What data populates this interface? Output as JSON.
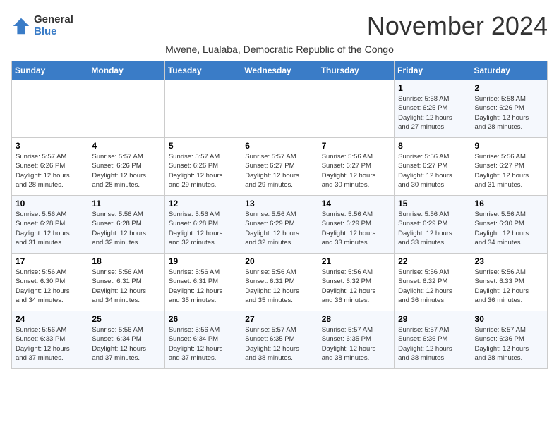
{
  "logo": {
    "general": "General",
    "blue": "Blue"
  },
  "title": "November 2024",
  "subtitle": "Mwene, Lualaba, Democratic Republic of the Congo",
  "days_of_week": [
    "Sunday",
    "Monday",
    "Tuesday",
    "Wednesday",
    "Thursday",
    "Friday",
    "Saturday"
  ],
  "weeks": [
    [
      {
        "day": "",
        "info": ""
      },
      {
        "day": "",
        "info": ""
      },
      {
        "day": "",
        "info": ""
      },
      {
        "day": "",
        "info": ""
      },
      {
        "day": "",
        "info": ""
      },
      {
        "day": "1",
        "info": "Sunrise: 5:58 AM\nSunset: 6:25 PM\nDaylight: 12 hours\nand 27 minutes."
      },
      {
        "day": "2",
        "info": "Sunrise: 5:58 AM\nSunset: 6:26 PM\nDaylight: 12 hours\nand 28 minutes."
      }
    ],
    [
      {
        "day": "3",
        "info": "Sunrise: 5:57 AM\nSunset: 6:26 PM\nDaylight: 12 hours\nand 28 minutes."
      },
      {
        "day": "4",
        "info": "Sunrise: 5:57 AM\nSunset: 6:26 PM\nDaylight: 12 hours\nand 28 minutes."
      },
      {
        "day": "5",
        "info": "Sunrise: 5:57 AM\nSunset: 6:26 PM\nDaylight: 12 hours\nand 29 minutes."
      },
      {
        "day": "6",
        "info": "Sunrise: 5:57 AM\nSunset: 6:27 PM\nDaylight: 12 hours\nand 29 minutes."
      },
      {
        "day": "7",
        "info": "Sunrise: 5:56 AM\nSunset: 6:27 PM\nDaylight: 12 hours\nand 30 minutes."
      },
      {
        "day": "8",
        "info": "Sunrise: 5:56 AM\nSunset: 6:27 PM\nDaylight: 12 hours\nand 30 minutes."
      },
      {
        "day": "9",
        "info": "Sunrise: 5:56 AM\nSunset: 6:27 PM\nDaylight: 12 hours\nand 31 minutes."
      }
    ],
    [
      {
        "day": "10",
        "info": "Sunrise: 5:56 AM\nSunset: 6:28 PM\nDaylight: 12 hours\nand 31 minutes."
      },
      {
        "day": "11",
        "info": "Sunrise: 5:56 AM\nSunset: 6:28 PM\nDaylight: 12 hours\nand 32 minutes."
      },
      {
        "day": "12",
        "info": "Sunrise: 5:56 AM\nSunset: 6:28 PM\nDaylight: 12 hours\nand 32 minutes."
      },
      {
        "day": "13",
        "info": "Sunrise: 5:56 AM\nSunset: 6:29 PM\nDaylight: 12 hours\nand 32 minutes."
      },
      {
        "day": "14",
        "info": "Sunrise: 5:56 AM\nSunset: 6:29 PM\nDaylight: 12 hours\nand 33 minutes."
      },
      {
        "day": "15",
        "info": "Sunrise: 5:56 AM\nSunset: 6:29 PM\nDaylight: 12 hours\nand 33 minutes."
      },
      {
        "day": "16",
        "info": "Sunrise: 5:56 AM\nSunset: 6:30 PM\nDaylight: 12 hours\nand 34 minutes."
      }
    ],
    [
      {
        "day": "17",
        "info": "Sunrise: 5:56 AM\nSunset: 6:30 PM\nDaylight: 12 hours\nand 34 minutes."
      },
      {
        "day": "18",
        "info": "Sunrise: 5:56 AM\nSunset: 6:31 PM\nDaylight: 12 hours\nand 34 minutes."
      },
      {
        "day": "19",
        "info": "Sunrise: 5:56 AM\nSunset: 6:31 PM\nDaylight: 12 hours\nand 35 minutes."
      },
      {
        "day": "20",
        "info": "Sunrise: 5:56 AM\nSunset: 6:31 PM\nDaylight: 12 hours\nand 35 minutes."
      },
      {
        "day": "21",
        "info": "Sunrise: 5:56 AM\nSunset: 6:32 PM\nDaylight: 12 hours\nand 36 minutes."
      },
      {
        "day": "22",
        "info": "Sunrise: 5:56 AM\nSunset: 6:32 PM\nDaylight: 12 hours\nand 36 minutes."
      },
      {
        "day": "23",
        "info": "Sunrise: 5:56 AM\nSunset: 6:33 PM\nDaylight: 12 hours\nand 36 minutes."
      }
    ],
    [
      {
        "day": "24",
        "info": "Sunrise: 5:56 AM\nSunset: 6:33 PM\nDaylight: 12 hours\nand 37 minutes."
      },
      {
        "day": "25",
        "info": "Sunrise: 5:56 AM\nSunset: 6:34 PM\nDaylight: 12 hours\nand 37 minutes."
      },
      {
        "day": "26",
        "info": "Sunrise: 5:56 AM\nSunset: 6:34 PM\nDaylight: 12 hours\nand 37 minutes."
      },
      {
        "day": "27",
        "info": "Sunrise: 5:57 AM\nSunset: 6:35 PM\nDaylight: 12 hours\nand 38 minutes."
      },
      {
        "day": "28",
        "info": "Sunrise: 5:57 AM\nSunset: 6:35 PM\nDaylight: 12 hours\nand 38 minutes."
      },
      {
        "day": "29",
        "info": "Sunrise: 5:57 AM\nSunset: 6:36 PM\nDaylight: 12 hours\nand 38 minutes."
      },
      {
        "day": "30",
        "info": "Sunrise: 5:57 AM\nSunset: 6:36 PM\nDaylight: 12 hours\nand 38 minutes."
      }
    ]
  ]
}
